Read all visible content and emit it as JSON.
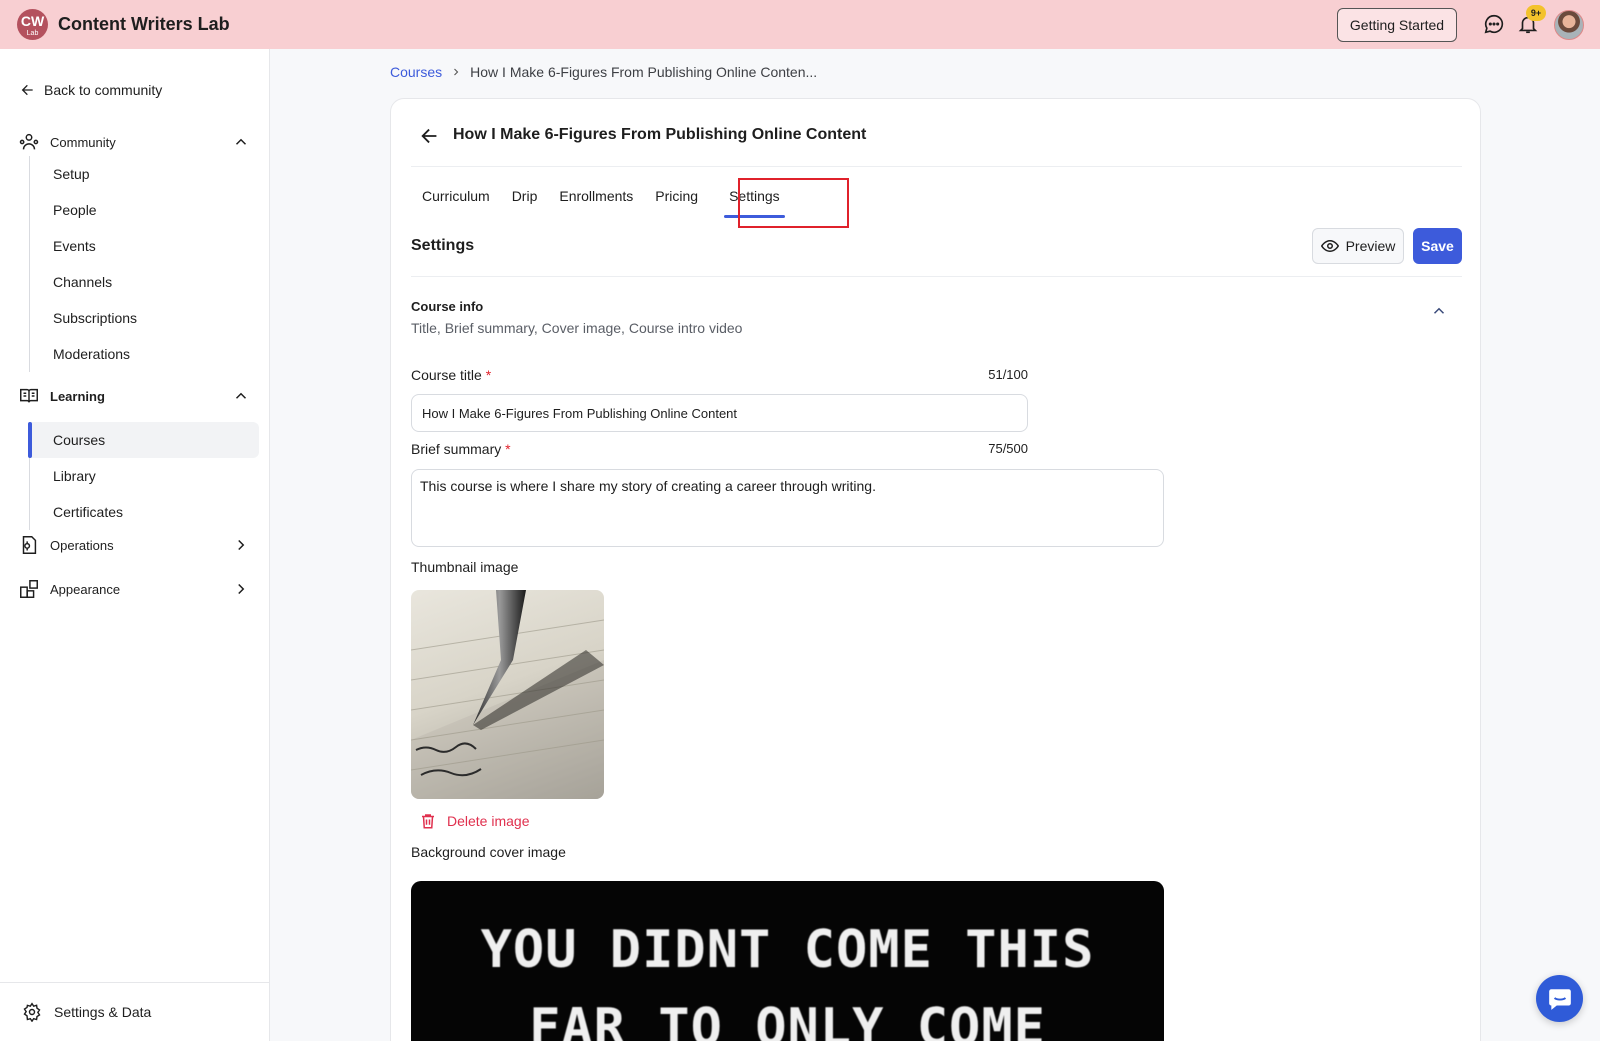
{
  "app": {
    "logo_line1": "CW",
    "logo_line2": "Lab",
    "name": "Content Writers Lab",
    "getting_started": "Getting Started",
    "notification_badge": "9+"
  },
  "sidebar": {
    "back_label": "Back to community",
    "community": {
      "label": "Community",
      "items": [
        "Setup",
        "People",
        "Events",
        "Channels",
        "Subscriptions",
        "Moderations"
      ]
    },
    "learning": {
      "label": "Learning",
      "items": [
        "Courses",
        "Library",
        "Certificates"
      ],
      "active": "Courses"
    },
    "operations_label": "Operations",
    "appearance_label": "Appearance",
    "footer_label": "Settings & Data"
  },
  "breadcrumb": {
    "root": "Courses",
    "current": "How I Make 6-Figures From Publishing Online Conten..."
  },
  "course": {
    "title": "How I Make 6-Figures From Publishing Online Content",
    "tabs": [
      "Curriculum",
      "Drip",
      "Enrollments",
      "Pricing",
      "Settings"
    ],
    "active_tab": "Settings"
  },
  "settings": {
    "heading": "Settings",
    "preview_label": "Preview",
    "save_label": "Save",
    "course_info": {
      "title": "Course info",
      "subtitle": "Title, Brief summary, Cover image, Course intro video"
    },
    "course_title_label": "Course title",
    "course_title_count": "51/100",
    "course_title_value": "How I Make 6-Figures From Publishing Online Content",
    "summary_label": "Brief summary",
    "summary_count": "75/500",
    "summary_value": "This course is where I share my story of creating a career through writing.",
    "thumbnail_label": "Thumbnail image",
    "delete_image_label": "Delete image",
    "cover_label": "Background cover image",
    "cover_text_line1": "YOU DIDNT COME THIS",
    "cover_text_line2": "FAR TO ONLY COME"
  },
  "colors": {
    "accent": "#3d5bdb",
    "topbar": "#f8cfd2",
    "danger": "#e0304e",
    "highlight": "#e0212b"
  }
}
